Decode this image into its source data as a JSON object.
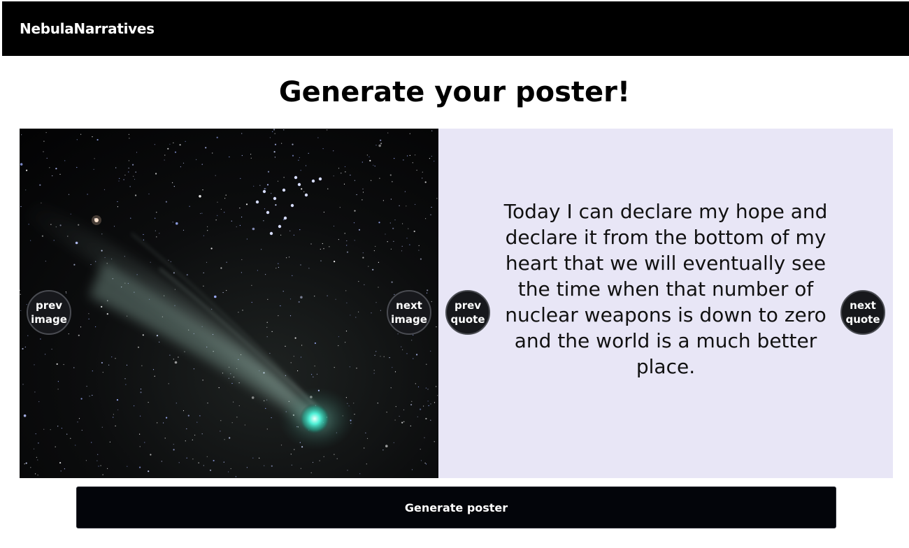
{
  "navbar": {
    "brand": "NebulaNarratives"
  },
  "main": {
    "title": "Generate your poster!"
  },
  "image_carousel": {
    "prev_label": "prev image",
    "next_label": "next image",
    "image_subject": "comet-night-sky"
  },
  "quote_carousel": {
    "prev_label": "prev quote",
    "next_label": "next quote",
    "quote": "Today I can declare my hope and declare it from the bottom of my heart that we will eventually see the time when that number of nuclear weapons is down to zero and the world is a much better place."
  },
  "actions": {
    "generate_label": "Generate poster"
  },
  "colors": {
    "navbar_bg": "#000000",
    "quote_panel_bg": "#e8e6f6",
    "button_bg": "#17181c",
    "generate_bg": "#03050a"
  }
}
